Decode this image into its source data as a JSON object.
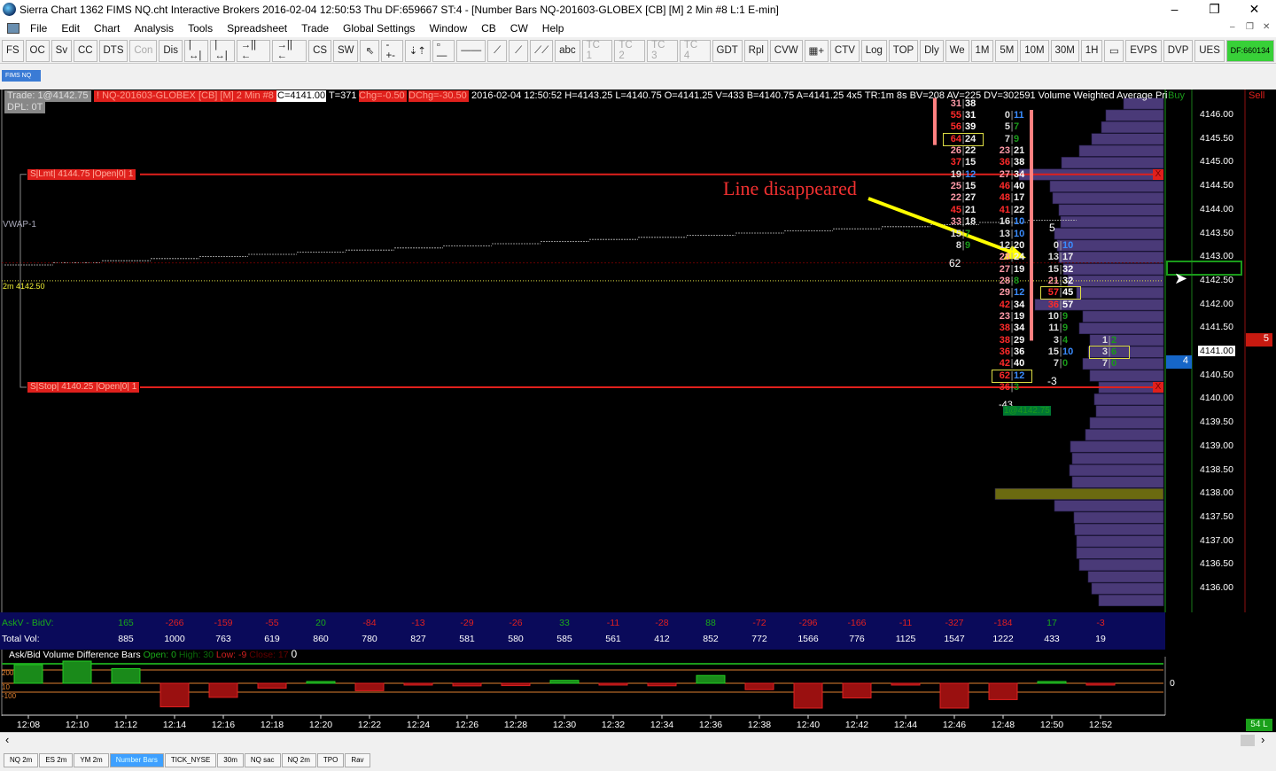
{
  "window": {
    "title": "Sierra Chart 1362 FIMS NQ.cht  Interactive Brokers 2016-02-04  12:50:53 Thu  DF:659667  ST:4 - [Number Bars  NQ-201603-GLOBEX [CB] [M]  2 Min   #8  L:1  E-min]",
    "controls": [
      "–",
      "❐",
      "✕"
    ]
  },
  "menu": [
    "File",
    "Edit",
    "Chart",
    "Analysis",
    "Tools",
    "Spreadsheet",
    "Trade",
    "Global Settings",
    "Window",
    "CB",
    "CW",
    "Help"
  ],
  "toolbar": [
    {
      "l": "FS"
    },
    {
      "l": "OC"
    },
    {
      "l": "Sv"
    },
    {
      "l": "CC"
    },
    {
      "l": "DTS"
    },
    {
      "l": "Con",
      "d": true
    },
    {
      "l": "Dis"
    },
    {
      "l": "|↔|"
    },
    {
      "l": "|↔|"
    },
    {
      "l": "→||←"
    },
    {
      "l": "→||←"
    },
    {
      "l": "CS"
    },
    {
      "l": "SW"
    },
    {
      "l": "⇖"
    },
    {
      "l": "-+-"
    },
    {
      "l": "⇣⇡"
    },
    {
      "l": "▫—"
    },
    {
      "l": "——"
    },
    {
      "l": "⟋"
    },
    {
      "l": "⟋"
    },
    {
      "l": "⟋⟋"
    },
    {
      "l": "abc"
    },
    {
      "l": "TC 1",
      "d": true
    },
    {
      "l": "TC 2",
      "d": true
    },
    {
      "l": "TC 3",
      "d": true
    },
    {
      "l": "TC 4",
      "d": true
    },
    {
      "l": "GDT"
    },
    {
      "l": "Rpl"
    },
    {
      "l": "CVW"
    },
    {
      "l": "▦+"
    },
    {
      "l": "CTV"
    },
    {
      "l": "Log"
    },
    {
      "l": "TOP"
    },
    {
      "l": "Dly"
    },
    {
      "l": "We"
    },
    {
      "l": "1M"
    },
    {
      "l": "5M"
    },
    {
      "l": "10M"
    },
    {
      "l": "30M"
    },
    {
      "l": "1H"
    },
    {
      "l": "▭"
    },
    {
      "l": "EVPS"
    },
    {
      "l": "DVP"
    },
    {
      "l": "UES"
    },
    {
      "l": "DF:660134",
      "g": true
    }
  ],
  "small_tab": "FIMS NQ",
  "info": {
    "trade": "Trade: 1@4142.75",
    "dpl": "DPL: 0T",
    "symbol": "! NQ-201603-GLOBEX [CB] [M]  2 Min   #8",
    "close": "C=4141.00",
    "t": "T=371",
    "chg": "Chg=-0.50",
    "dchg": "DChg=-30.50",
    "rest": "2016-02-04 12:50:52 H=4143.25 L=4140.75 O=4141.25 V=433 B=4140.75 A=4141.25 4x5 TR:1m 8s BV=208 AV=225 DV=302591 Volume Weighted Average Pri",
    "buy": "Buy",
    "sell": "Sell"
  },
  "orders": {
    "limit": {
      "label": "S|Lmt| 4144.75 |Open|0| 1",
      "price": 4144.75,
      "x": "X"
    },
    "stop": {
      "label": "S|Stop| 4140.25 |Open|0| 1",
      "price": 4140.25,
      "x": "X"
    }
  },
  "vwap_label": "VWAP-1",
  "last_label": "2m  4142.50",
  "annotation": "Line  disappeared",
  "colors": {
    "bid_strong": "#ff2a2a",
    "bid": "#ff9aa8",
    "ask": "#ffffff",
    "ask_blue": "#3a8cff",
    "ask_green": "#1a9a1a",
    "profile": "#4a3a78",
    "order_line": "#e0201c",
    "poc": "#6b6a10"
  },
  "price_axis": [
    "4146.00",
    "4145.50",
    "4145.00",
    "4144.50",
    "4144.00",
    "4143.50",
    "4143.00",
    "4142.50",
    "4142.00",
    "4141.50",
    "4141.00",
    "4140.50",
    "4140.00",
    "4139.50",
    "4139.00",
    "4138.50",
    "4138.00",
    "4137.50",
    "4137.00",
    "4136.50",
    "4136.00"
  ],
  "current_price": "4141.00",
  "dom": {
    "bid_size": "4",
    "ask_size": "5"
  },
  "number_bars": [
    {
      "top": 4146.25,
      "rows": [
        [
          31,
          38
        ],
        [
          55,
          31
        ],
        [
          56,
          39
        ],
        [
          64,
          24
        ],
        [
          26,
          22
        ],
        [
          37,
          15
        ],
        [
          19,
          12
        ],
        [
          25,
          15
        ],
        [
          22,
          27
        ],
        [
          45,
          21
        ],
        [
          33,
          18
        ],
        [
          15,
          7
        ],
        [
          8,
          9
        ]
      ],
      "delta": "62"
    },
    {
      "top": 4146.0,
      "rows": [
        [
          0,
          11
        ],
        [
          5,
          7
        ],
        [
          7,
          9
        ],
        [
          23,
          21
        ],
        [
          36,
          38
        ],
        [
          27,
          34
        ],
        [
          46,
          40
        ],
        [
          48,
          17
        ],
        [
          41,
          22
        ],
        [
          16,
          10
        ],
        [
          13,
          10
        ],
        [
          12,
          20
        ],
        [
          28,
          24
        ],
        [
          27,
          19
        ],
        [
          28,
          8
        ],
        [
          29,
          12
        ],
        [
          42,
          34
        ],
        [
          23,
          19
        ],
        [
          38,
          34
        ],
        [
          38,
          29
        ],
        [
          36,
          36
        ],
        [
          42,
          40
        ],
        [
          62,
          12
        ],
        [
          36,
          3
        ]
      ],
      "delta": "-43"
    },
    {
      "top": 4143.25,
      "rows": [
        [
          0,
          10
        ],
        [
          13,
          17
        ],
        [
          15,
          32
        ],
        [
          21,
          32
        ],
        [
          57,
          45
        ],
        [
          36,
          57
        ],
        [
          10,
          9
        ],
        [
          11,
          9
        ],
        [
          3,
          4
        ],
        [
          15,
          10
        ],
        [
          7,
          0
        ]
      ],
      "delta": "5",
      "delta2": "-3"
    },
    {
      "top": 4141.25,
      "rows": [
        [
          1,
          2
        ],
        [
          3,
          6
        ],
        [
          7,
          0
        ]
      ]
    }
  ],
  "volume_profile": {
    "top": 4146.25,
    "relative": [
      45,
      65,
      70,
      81,
      95,
      115,
      163,
      128,
      125,
      118,
      116,
      123,
      120,
      118,
      113,
      108,
      98,
      145,
      91,
      95,
      83,
      85,
      91,
      83,
      73,
      78,
      76,
      83,
      88,
      105,
      103,
      106,
      103,
      190,
      123,
      101,
      100,
      98,
      98,
      95,
      85,
      81,
      73
    ]
  },
  "bar_label": "1@4142.75",
  "summary": {
    "askbid_label": "AskV - BidV:",
    "askbid": [
      165,
      -266,
      -159,
      -55,
      20,
      -84,
      -13,
      -29,
      -26,
      33,
      -11,
      -28,
      88,
      -72,
      -296,
      -166,
      -11,
      -327,
      -184,
      17,
      -3
    ],
    "total_label": "Total Vol:",
    "total": [
      885,
      1000,
      763,
      619,
      860,
      780,
      827,
      581,
      580,
      585,
      561,
      412,
      852,
      772,
      1566,
      776,
      1125,
      1547,
      1222,
      433,
      19
    ]
  },
  "subchart": {
    "title": "Ask/Bid Volume Difference Bars",
    "open": "Open: 0",
    "high": "High: 30",
    "low": "Low: -9",
    "close": "Close: 17",
    "value": "0",
    "levels": [
      "200",
      "10",
      "-100"
    ],
    "zero": "0",
    "bars": [
      210,
      250,
      165,
      -266,
      -159,
      -55,
      20,
      -84,
      -13,
      -29,
      -26,
      33,
      -11,
      -28,
      88,
      -72,
      -296,
      -166,
      -11,
      -327,
      -184,
      17,
      -3
    ]
  },
  "time_axis": [
    "12:08",
    "12:10",
    "12:12",
    "12:14",
    "12:16",
    "12:18",
    "12:20",
    "12:22",
    "12:24",
    "12:26",
    "12:28",
    "12:30",
    "12:32",
    "12:34",
    "12:36",
    "12:38",
    "12:40",
    "12:42",
    "12:44",
    "12:46",
    "12:48",
    "12:50",
    "12:52"
  ],
  "status_badge": "54 L",
  "chart_tabs": [
    {
      "l": "NQ 2m"
    },
    {
      "l": "ES 2m"
    },
    {
      "l": "YM 2m"
    },
    {
      "l": "Number Bars",
      "active": true
    },
    {
      "l": "TICK_NYSE"
    },
    {
      "l": "30m"
    },
    {
      "l": "NQ sac"
    },
    {
      "l": "NQ 2m"
    },
    {
      "l": "TPO"
    },
    {
      "l": "Rav"
    }
  ]
}
